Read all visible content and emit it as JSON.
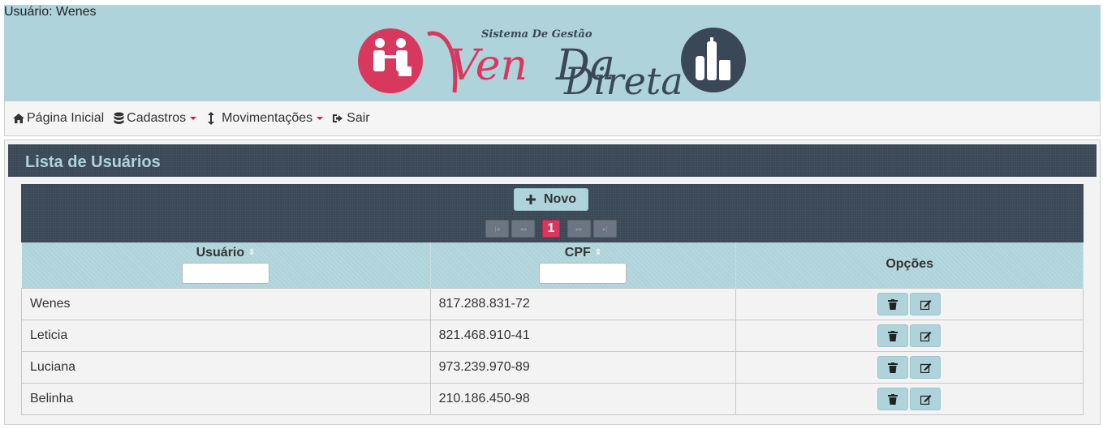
{
  "header": {
    "user_label": "Usuário: Wenes",
    "logo_subtitle": "Sistema De Gestão",
    "logo_word1": "Ven",
    "logo_word2": "Da",
    "logo_word3": "Direta"
  },
  "menu": [
    {
      "label": "Página Inicial",
      "icon": "home-icon"
    },
    {
      "label": "Cadastros",
      "icon": "database-icon",
      "dropdown": true
    },
    {
      "label": "Movimentações",
      "icon": "vertical-arrows-icon",
      "dropdown": true
    },
    {
      "label": "Sair",
      "icon": "logout-icon"
    }
  ],
  "panel": {
    "title": "Lista de Usuários",
    "new_button": "Novo",
    "current_page": "1"
  },
  "table": {
    "columns": [
      "Usuário",
      "CPF",
      "Opções"
    ],
    "rows": [
      {
        "usuario": "Wenes",
        "cpf": "817.288.831-72"
      },
      {
        "usuario": "Leticia",
        "cpf": "821.468.910-41"
      },
      {
        "usuario": "Luciana",
        "cpf": "973.239.970-89"
      },
      {
        "usuario": "Belinha",
        "cpf": "210.186.450-98"
      }
    ]
  },
  "colors": {
    "accent": "#aed3da",
    "dark": "#3a4756",
    "brand": "#d9385e"
  }
}
